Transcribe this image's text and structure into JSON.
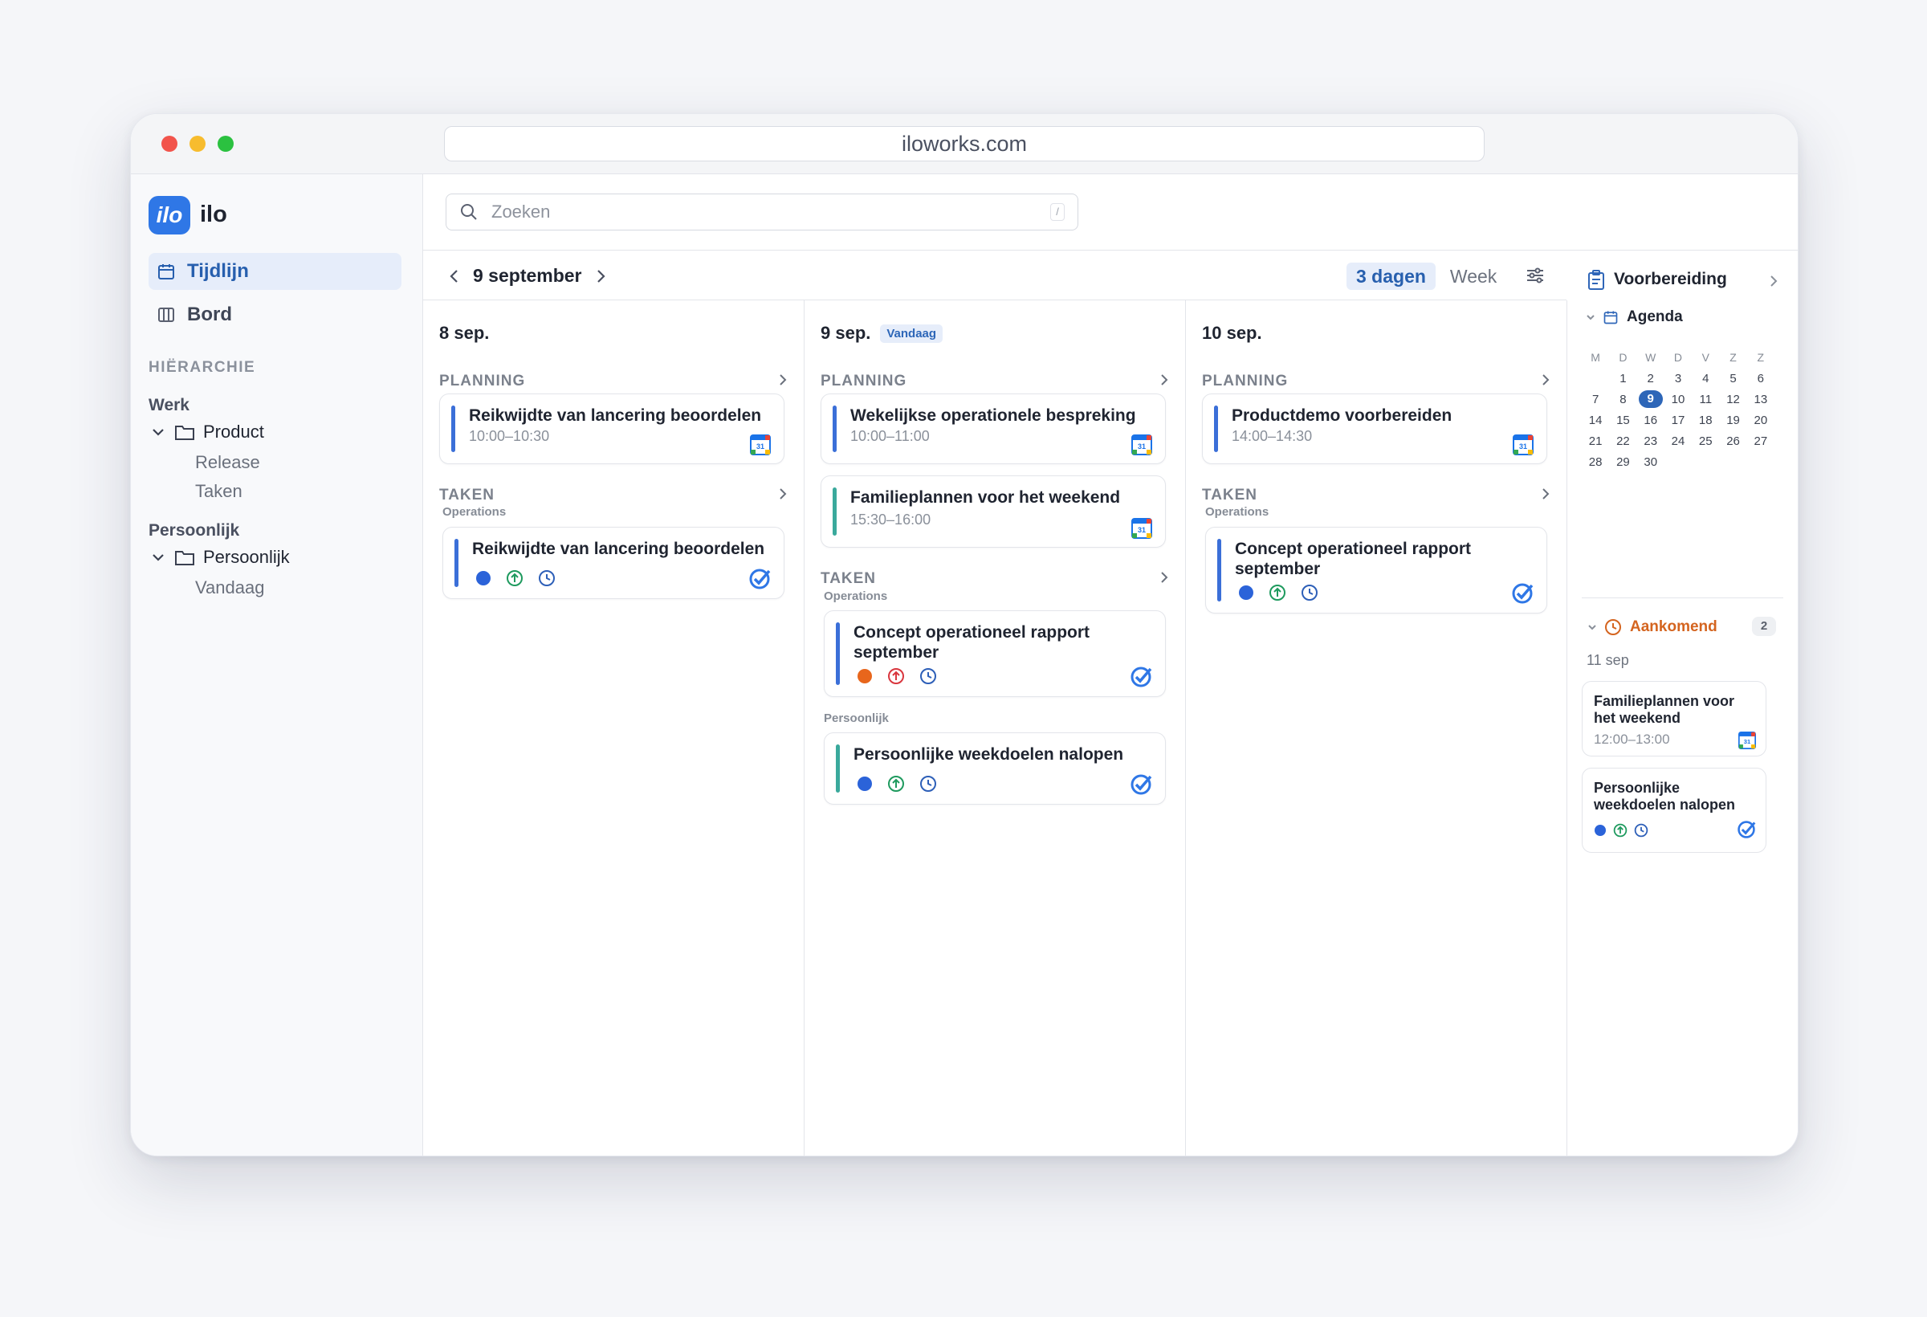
{
  "browser": {
    "url": "iloworks.com"
  },
  "sidebar": {
    "logo_text": "ilo",
    "brand": "ilo",
    "nav": [
      {
        "label": "Tijdlijn",
        "icon": "calendar-icon"
      },
      {
        "label": "Bord",
        "icon": "board-columns-icon"
      }
    ],
    "hierarchy_title": "HIËRARCHIE",
    "groups": [
      {
        "title": "Werk",
        "folder": "Product",
        "items": [
          "Release",
          "Taken"
        ]
      },
      {
        "title": "Persoonlijk",
        "folder": "Persoonlijk",
        "items": [
          "Vandaag"
        ]
      }
    ]
  },
  "topbar": {
    "search_placeholder": "Zoeken",
    "search_shortcut": "/"
  },
  "datebar": {
    "current": "9 september",
    "views": [
      "3 dagen",
      "Week"
    ],
    "active_view": "3 dagen"
  },
  "columns": [
    {
      "date": "8 sep.",
      "planning_label": "PLANNING",
      "events": [
        {
          "title": "Reikwijdte van lancering beoordelen",
          "time": "10:00–10:30"
        }
      ],
      "tasks_label": "TAKEN",
      "task_groups": [
        {
          "label": "Operations",
          "tasks": [
            {
              "title": "Reikwijdte van lancering beoordelen"
            }
          ]
        }
      ]
    },
    {
      "date": "9 sep.",
      "today_badge": "Vandaag",
      "planning_label": "PLANNING",
      "events": [
        {
          "title": "Wekelijkse operationele bespreking",
          "time": "10:00–11:00"
        },
        {
          "title": "Familieplannen voor het weekend",
          "time": "15:30–16:00"
        }
      ],
      "tasks_label": "TAKEN",
      "task_groups": [
        {
          "label": "Operations",
          "tasks": [
            {
              "title": "Concept operationeel rapport september"
            }
          ]
        },
        {
          "label": "Persoonlijk",
          "tasks": [
            {
              "title": "Persoonlijke weekdoelen nalopen"
            }
          ]
        }
      ]
    },
    {
      "date": "10 sep.",
      "planning_label": "PLANNING",
      "events": [
        {
          "title": "Productdemo voorbereiden",
          "time": "14:00–14:30"
        }
      ],
      "tasks_label": "TAKEN",
      "task_groups": [
        {
          "label": "Operations",
          "tasks": [
            {
              "title": "Concept operationeel rapport september"
            }
          ]
        }
      ]
    }
  ],
  "right_panel": {
    "title": "Voorbereiding",
    "agenda_label": "Agenda",
    "calendar": {
      "weekdays": [
        "M",
        "D",
        "W",
        "D",
        "V",
        "Z",
        "Z"
      ],
      "weeks": [
        [
          "",
          "1",
          "2",
          "3",
          "4",
          "5",
          "6"
        ],
        [
          "7",
          "8",
          "9",
          "10",
          "11",
          "12",
          "13"
        ],
        [
          "14",
          "15",
          "16",
          "17",
          "18",
          "19",
          "20"
        ],
        [
          "21",
          "22",
          "23",
          "24",
          "25",
          "26",
          "27"
        ],
        [
          "28",
          "29",
          "30",
          "",
          "",
          "",
          ""
        ]
      ],
      "selected": "9"
    },
    "upcoming_label": "Aankomend",
    "upcoming_count": "2",
    "upcoming_date": "11 sep",
    "upcoming_items": [
      {
        "title": "Familieplannen voor het weekend",
        "time": "12:00–13:00"
      },
      {
        "title": "Persoonlijke weekdoelen nalopen"
      }
    ]
  },
  "colors": {
    "accent": "#2f77e6",
    "bar_blue": "#3b6fd8",
    "bar_teal": "#3aa99c",
    "dot_blue": "#2b63d9",
    "dot_orange": "#e8661c",
    "arrow_green": "#1e9a5e",
    "arrow_red": "#d9363e",
    "clock_blue": "#2d5fb8",
    "upcoming_orange": "#d4641f"
  }
}
